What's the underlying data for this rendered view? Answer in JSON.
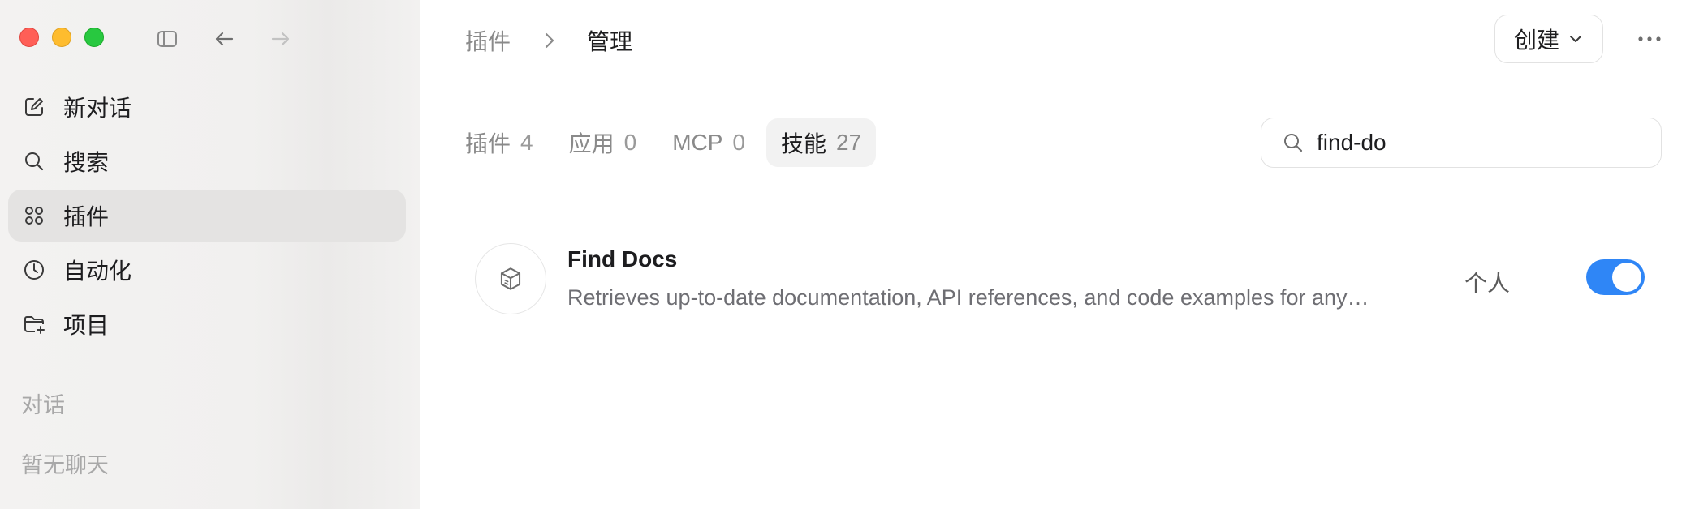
{
  "window": {
    "controls": [
      "close",
      "minimize",
      "zoom"
    ]
  },
  "toolbar": {
    "sidebar_toggle_icon": "sidebar-icon",
    "back_icon": "arrow-left-icon",
    "forward_icon": "arrow-right-icon"
  },
  "sidebar": {
    "items": [
      {
        "label": "新对话",
        "icon": "edit-icon"
      },
      {
        "label": "搜索",
        "icon": "search-icon"
      },
      {
        "label": "插件",
        "icon": "grid-icon",
        "active": true
      },
      {
        "label": "自动化",
        "icon": "clock-icon"
      },
      {
        "label": "项目",
        "icon": "folder-add-icon"
      }
    ],
    "section_title": "对话",
    "empty_text": "暂无聊天"
  },
  "header": {
    "breadcrumb_parent": "插件",
    "breadcrumb_current": "管理",
    "create_label": "创建",
    "more_icon": "more-icon"
  },
  "tabs": [
    {
      "label": "插件",
      "count": "4"
    },
    {
      "label": "应用",
      "count": "0"
    },
    {
      "label": "MCP",
      "count": "0"
    },
    {
      "label": "技能",
      "count": "27",
      "active": true
    }
  ],
  "search": {
    "value": "find-do"
  },
  "results": [
    {
      "title": "Find Docs",
      "description": "Retrieves up-to-date documentation, API references, and code examples for any…",
      "scope": "个人",
      "enabled": true,
      "icon": "cube-icon"
    }
  ],
  "colors": {
    "accent": "#2f86f6",
    "sidebar_bg": "#f3f2f1",
    "active_bg": "#e4e3e2"
  }
}
